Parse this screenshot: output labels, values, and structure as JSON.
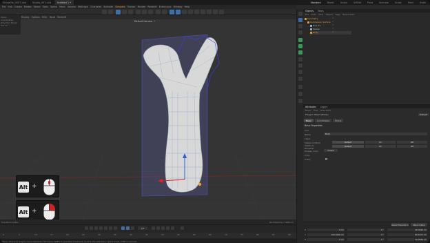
{
  "titlebar": {
    "tabs": [
      "Sinew0fz_0007.c4d",
      "Studio_007.c4d",
      "Untitled 1 *"
    ],
    "active_tab_index": 2,
    "layouts": [
      "Standard",
      "Model",
      "Sculpt",
      "UVEdit",
      "Paint",
      "Animate",
      "Script",
      "Track",
      "Scale"
    ],
    "active_layout": "Standard"
  },
  "menubar": {
    "items": [
      "File",
      "Edit",
      "Create",
      "Modes",
      "Select",
      "Tools",
      "Spline",
      "Mesh",
      "Volume",
      "MoGraph",
      "Character",
      "Animate",
      "Simulate",
      "Tracker",
      "Render",
      "Redshift",
      "Extensions",
      "Window",
      "Help"
    ],
    "highlight": "Simulate",
    "accent_color": "#e8a13a"
  },
  "leftpanel": {
    "lines": [
      "Pelvis",
      "Coordinates",
      "Direction Tweak",
      "Pos  12  …"
    ]
  },
  "viewport": {
    "menu": [
      "View",
      "Cameras",
      "Display",
      "Options",
      "Filter",
      "Panel",
      "Redshift"
    ],
    "camera_label": "Default Camera ·•",
    "footer_left": "Transform  Scale",
    "footer_right": "Grid Spacing : 1000 cm",
    "mesh_color": "#d8d8d8",
    "bbox_color": "#4a4aa8"
  },
  "hints": [
    {
      "key": "Alt",
      "plus": "+",
      "mouse_button": "middle",
      "highlight_color": "#cc2222"
    },
    {
      "key": "Alt",
      "plus": "+",
      "mouse_button": "right",
      "highlight_color": "#cc2222"
    }
  ],
  "timeline": {
    "current_frame": "0 F",
    "ruler": [
      "0",
      "5",
      "10",
      "15",
      "20",
      "25",
      "30",
      "35",
      "40",
      "45",
      "50",
      "55",
      "60",
      "65",
      "70",
      "75",
      "80",
      "85",
      "90"
    ],
    "status": "Move: Click and drag to move elements. Hold down SHIFT to quantize movement / add to the selection in point mode, CTRL to remove."
  },
  "objects": {
    "tabs": [
      "Objects",
      "Takes"
    ],
    "menu": [
      "File",
      "Edit",
      "View",
      "Object",
      "Tags",
      "Bookmarks"
    ],
    "rows": [
      {
        "name": "Symmetry",
        "color": "#e8a13a",
        "indent": 0
      },
      {
        "name": "Subdivision Surface",
        "color": "#e8a13a",
        "indent": 1
      },
      {
        "name": "Null_01",
        "color": "#9bd",
        "indent": 2
      },
      {
        "name": "Sweep",
        "color": "#9bd",
        "indent": 2
      },
      {
        "name": "Body",
        "color": "#e8a13a",
        "indent": 2
      }
    ]
  },
  "attributes": {
    "tabs": [
      "Attributes",
      "Layers"
    ],
    "menu": [
      "Mode",
      "Edit",
      "User Data"
    ],
    "object_label": "Polygon Object [Body]",
    "subtabs": [
      "Basic",
      "Coordinates",
      "Phong"
    ],
    "active_subtab": "Basic",
    "section": "Basic Properties",
    "icon_label": "Icon",
    "name_label": "Name",
    "name_value": "Body",
    "layer_label": "Layer",
    "rows": [
      {
        "label": "Visible in Editor",
        "value": "Default",
        "b": "On",
        "c": "Off"
      },
      {
        "label": "Visible in Renderer",
        "value": "Default",
        "b": "On",
        "c": "Off"
      },
      {
        "label": "Display Color",
        "value": "Inherit",
        "b": "",
        "c": ""
      },
      {
        "label": "Color",
        "value": "",
        "b": "",
        "c": ""
      },
      {
        "label": "X-Ray",
        "value": "",
        "b": "",
        "c": ""
      }
    ],
    "default_button": "Default"
  },
  "coords": {
    "buttons": [
      "Reset Transform",
      "Object (Rel)"
    ],
    "rows": [
      {
        "axis": "X",
        "pos": "0 cm",
        "rot": "0 °",
        "scale": "40.3295 cm"
      },
      {
        "axis": "Y",
        "pos": "100.0106 cm",
        "rot": "0 °",
        "scale": "89.1971 cm"
      },
      {
        "axis": "Z",
        "pos": "0 cm",
        "rot": "0 °",
        "scale": "39.3586 cm"
      }
    ]
  }
}
